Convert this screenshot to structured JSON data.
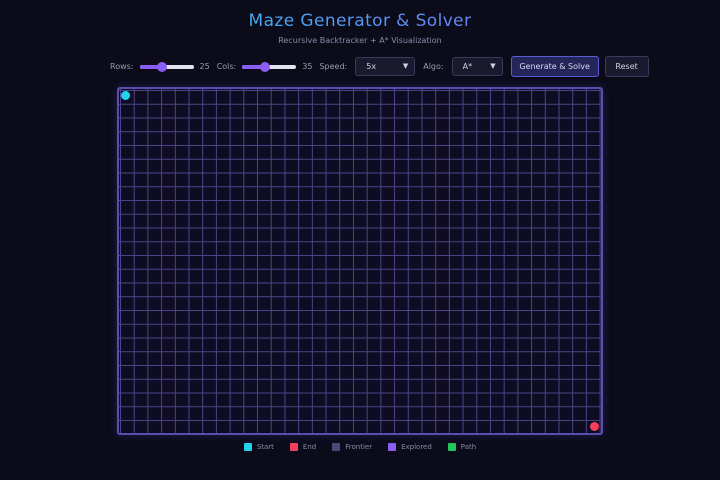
{
  "header": {
    "title": "Maze Generator & Solver",
    "subtitle": "Recursive Backtracker + A* Visualization"
  },
  "controls": {
    "rows": {
      "label": "Rows:",
      "value": "25",
      "fraction": 0.42
    },
    "cols": {
      "label": "Cols:",
      "value": "35",
      "fraction": 0.42
    },
    "speed": {
      "label": "Speed:",
      "selected": "5x"
    },
    "algo": {
      "label": "Algo:",
      "selected": "A*"
    },
    "generate_label": "Generate & Solve",
    "reset_label": "Reset"
  },
  "maze": {
    "rows": 25,
    "cols": 35,
    "start_color": "#22d3ee",
    "end_color": "#f43f5e"
  },
  "legend": [
    {
      "label": "Start",
      "color": "#22d3ee"
    },
    {
      "label": "End",
      "color": "#f43f5e"
    },
    {
      "label": "Frontier",
      "color": "#4b4b78"
    },
    {
      "label": "Explored",
      "color": "#8b5cf6"
    },
    {
      "label": "Path",
      "color": "#22c55e"
    }
  ],
  "icons": {
    "select_chevron": "chevron-down-icon"
  }
}
